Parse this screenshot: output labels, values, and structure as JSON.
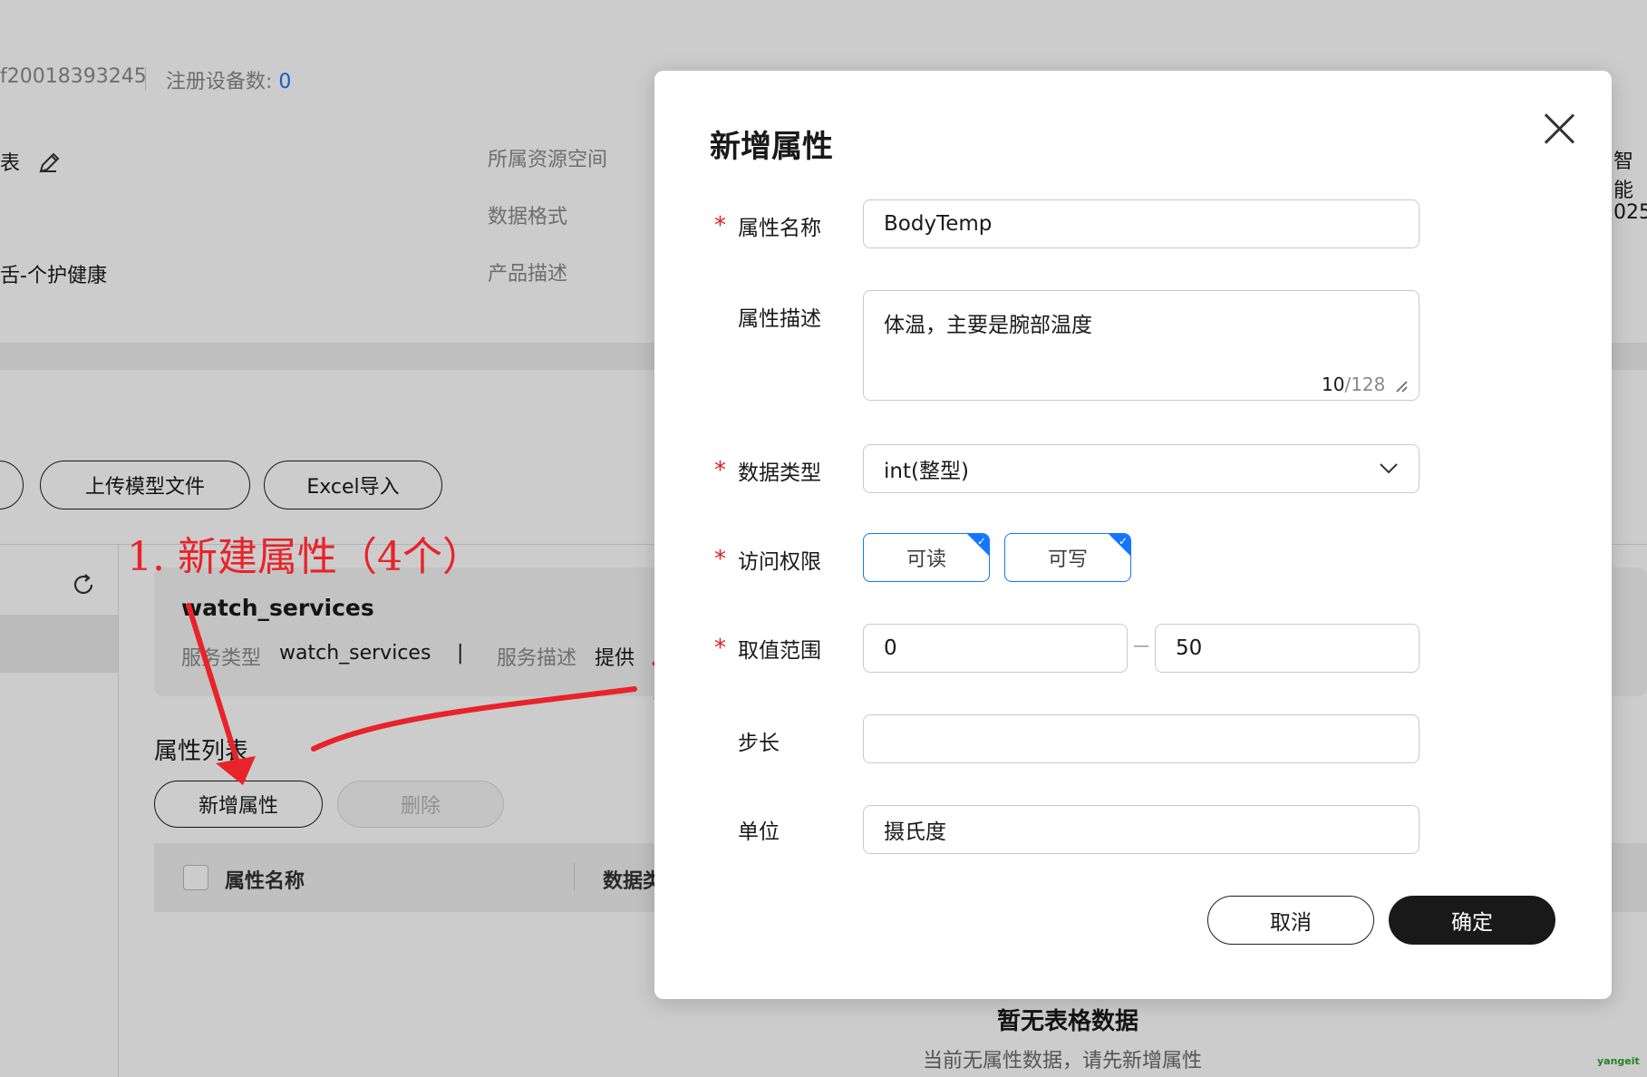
{
  "page": {
    "header": {
      "id_fragment": "f20018393245",
      "device_count_label": "注册设备数: ",
      "device_count_value": "0"
    },
    "info": {
      "left_frag1": "表",
      "left_frag3": "舌-个护健康",
      "resource_space_label": "所属资源空间",
      "data_format_label": "数据格式",
      "product_desc_label": "产品描述",
      "right_frag1": "智能",
      "right_frag2": "025"
    },
    "toolbar": {
      "upload_model": "上传模型文件",
      "excel_import": "Excel导入"
    },
    "annotation": {
      "text": "1. 新建属性（4个）"
    },
    "service": {
      "name": "watch_services",
      "type_label": "服务类型",
      "type_value": "watch_services",
      "separator": "|",
      "desc_label": "服务描述",
      "desc_value": "提供"
    },
    "property_list": {
      "title": "属性列表",
      "add_button": "新增属性",
      "delete_button": "删除",
      "col_name": "属性名称",
      "col_type": "数据类",
      "empty_title": "暂无表格数据",
      "empty_desc": "当前无属性数据，请先新增属性"
    },
    "watermark": "yangeit"
  },
  "modal": {
    "title": "新增属性",
    "required_mark": "*",
    "fields": {
      "name_label": "属性名称",
      "name_value": "BodyTemp",
      "desc_label": "属性描述",
      "desc_value": "体温，主要是腕部温度",
      "desc_count": "10",
      "desc_max": "/128",
      "type_label": "数据类型",
      "type_value": "int(整型)",
      "access_label": "访问权限",
      "access_read": "可读",
      "access_write": "可写",
      "range_label": "取值范围",
      "range_min": "0",
      "range_dash": "—",
      "range_max": "50",
      "step_label": "步长",
      "step_value": "",
      "unit_label": "单位",
      "unit_value": "摄氏度"
    },
    "cancel_button": "取消",
    "confirm_button": "确定"
  },
  "colors": {
    "accent": "#1476ff",
    "required": "#e02020",
    "annotation": "#e8232a"
  }
}
